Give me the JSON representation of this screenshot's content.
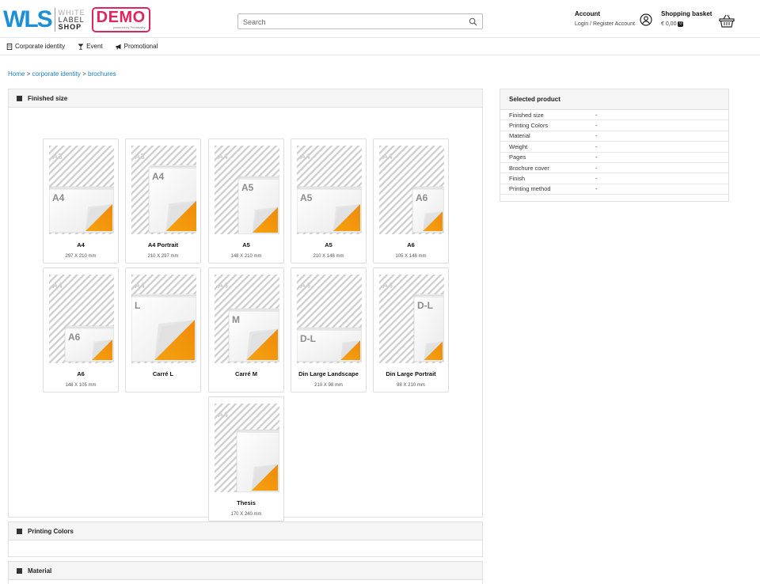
{
  "header": {
    "logo": {
      "mark": "WLS",
      "line1": "WHITE",
      "line2": "LABEL",
      "line3": "SHOP",
      "demo": "DEMO",
      "demo_sub": "powered by Printdustry"
    },
    "search_placeholder": "Search",
    "account": {
      "title": "Account",
      "login": "Login",
      "separator": "/",
      "register": "Register Account"
    },
    "basket": {
      "title": "Shopping basket",
      "amount": "€ 0,00",
      "count": "0"
    }
  },
  "nav": [
    {
      "label": "Corporate identity",
      "icon": "building-icon"
    },
    {
      "label": "Event",
      "icon": "cocktail-glass-icon"
    },
    {
      "label": "Promotional",
      "icon": "megaphone-icon"
    }
  ],
  "breadcrumb": {
    "home": "Home",
    "sep": ">",
    "level1": "corporate identity",
    "level2": "brochures"
  },
  "sections": {
    "finished_size": "Finished size",
    "printing_colors": "Printing Colors",
    "material": "Material"
  },
  "products": [
    {
      "name": "A4",
      "dims": "297 X 210 mm",
      "bg": "A3",
      "fg": "A4"
    },
    {
      "name": "A4 Portrait",
      "dims": "210 X 297 mm",
      "bg": "A3",
      "fg": "A4"
    },
    {
      "name": "A5",
      "dims": "148 X 210 mm",
      "bg": "A4",
      "fg": "A5"
    },
    {
      "name": "A5",
      "dims": "210 X 148 mm",
      "bg": "A4",
      "fg": "A5"
    },
    {
      "name": "A6",
      "dims": "105 X 148 mm",
      "bg": "A4",
      "fg": "A6"
    },
    {
      "name": "A6",
      "dims": "148 X 105 mm",
      "bg": "A4",
      "fg": "A6"
    },
    {
      "name": "Carré L",
      "dims": "",
      "bg": "A4",
      "fg": "L"
    },
    {
      "name": "Carré M",
      "dims": "",
      "bg": "A4",
      "fg": "M"
    },
    {
      "name": "Din Large Landscape",
      "dims": "210 X 98 mm",
      "bg": "A4",
      "fg": "D-L"
    },
    {
      "name": "Din Large Portrait",
      "dims": "98 X 210 mm",
      "bg": "A4",
      "fg": "D-L"
    },
    {
      "name": "Thesis",
      "dims": "170 X 240 mm",
      "bg": "A4",
      "fg": ""
    }
  ],
  "selected_product": {
    "title": "Selected product",
    "rows": [
      {
        "label": "Finished size",
        "value": "-"
      },
      {
        "label": "Printing Colors",
        "value": "-"
      },
      {
        "label": "Material",
        "value": "-"
      },
      {
        "label": "Weight",
        "value": "-"
      },
      {
        "label": "Pages",
        "value": "-"
      },
      {
        "label": "Brochure cover",
        "value": "-"
      },
      {
        "label": "Finish",
        "value": "-"
      },
      {
        "label": "Printing method",
        "value": "-"
      }
    ]
  },
  "colors": {
    "brand_blue": "#1d8fd6",
    "demo_red": "#e0245e",
    "link": "#1d7fc0",
    "accent_orange": "#f5a30f"
  }
}
